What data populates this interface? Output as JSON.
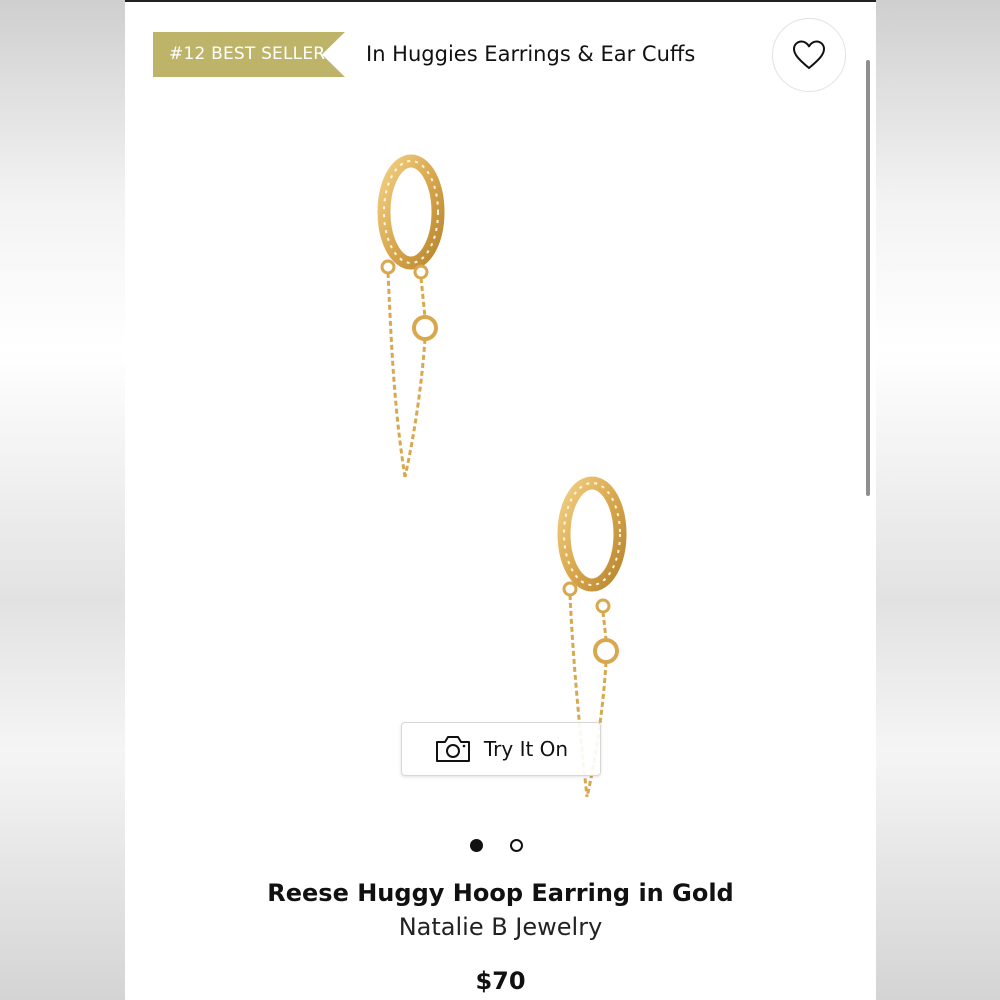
{
  "badge": {
    "label": "#12 BEST SELLER",
    "color": "#bdb46a"
  },
  "category": {
    "text": "In Huggies Earrings & Ear Cuffs"
  },
  "wishlist": {
    "icon": "heart-icon"
  },
  "try_on": {
    "label": "Try It On",
    "icon": "camera-icon"
  },
  "carousel": {
    "total": 2,
    "active_index": 1
  },
  "product": {
    "title": "Reese Huggy Hoop Earring in Gold",
    "brand": "Natalie B Jewelry",
    "price": "$70",
    "image": "gold-huggy-hoop-earrings-with-chain"
  },
  "colors": {
    "gold": "#d9a84e",
    "text": "#111111"
  }
}
